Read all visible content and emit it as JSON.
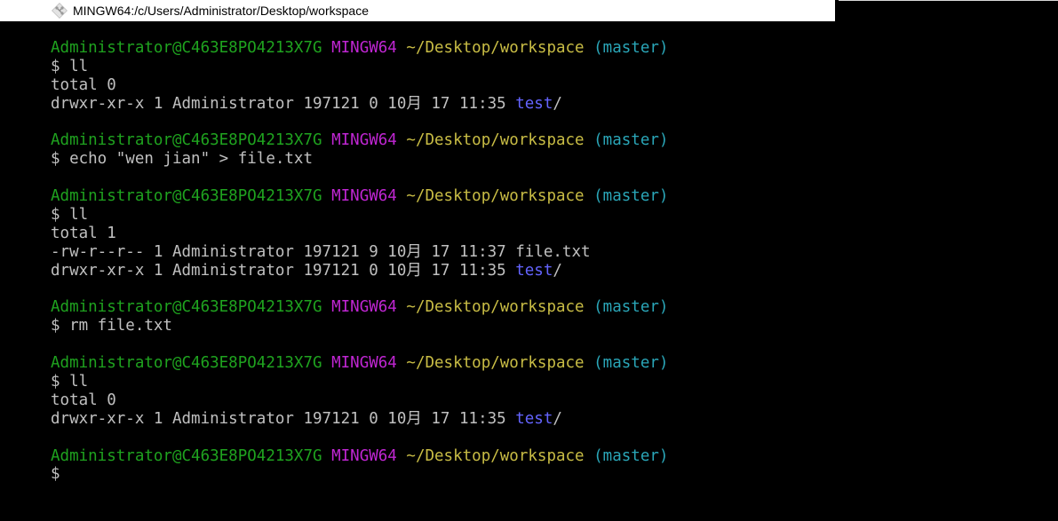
{
  "window": {
    "title": "MINGW64:/c/Users/Administrator/Desktop/workspace",
    "icon": "git-bash-icon"
  },
  "colors": {
    "background": "#000000",
    "default_text": "#c0c0c0",
    "user_host": "#1fa31f",
    "shell_name": "#c026d3",
    "path": "#c9bd45",
    "branch": "#2aa6b8",
    "directory": "#6464ff"
  },
  "terminal": {
    "lines": [
      {
        "type": "prompt",
        "segments": [
          {
            "text": "Administrator@C463E8PO4213X7G",
            "color": "user_host"
          },
          {
            "text": " "
          },
          {
            "text": "MINGW64",
            "color": "shell_name"
          },
          {
            "text": " "
          },
          {
            "text": "~/Desktop/workspace",
            "color": "path"
          },
          {
            "text": " "
          },
          {
            "text": "(master)",
            "color": "branch"
          }
        ]
      },
      {
        "type": "command",
        "segments": [
          {
            "text": "$ ll"
          }
        ]
      },
      {
        "type": "output",
        "segments": [
          {
            "text": "total 0"
          }
        ]
      },
      {
        "type": "output",
        "segments": [
          {
            "text": "drwxr-xr-x 1 Administrator 197121 0 10月 17 11:35 "
          },
          {
            "text": "test",
            "color": "directory"
          },
          {
            "text": "/"
          }
        ]
      },
      {
        "type": "blank",
        "segments": []
      },
      {
        "type": "prompt",
        "segments": [
          {
            "text": "Administrator@C463E8PO4213X7G",
            "color": "user_host"
          },
          {
            "text": " "
          },
          {
            "text": "MINGW64",
            "color": "shell_name"
          },
          {
            "text": " "
          },
          {
            "text": "~/Desktop/workspace",
            "color": "path"
          },
          {
            "text": " "
          },
          {
            "text": "(master)",
            "color": "branch"
          }
        ]
      },
      {
        "type": "command",
        "segments": [
          {
            "text": "$ echo \"wen jian\" > file.txt"
          }
        ]
      },
      {
        "type": "blank",
        "segments": []
      },
      {
        "type": "prompt",
        "segments": [
          {
            "text": "Administrator@C463E8PO4213X7G",
            "color": "user_host"
          },
          {
            "text": " "
          },
          {
            "text": "MINGW64",
            "color": "shell_name"
          },
          {
            "text": " "
          },
          {
            "text": "~/Desktop/workspace",
            "color": "path"
          },
          {
            "text": " "
          },
          {
            "text": "(master)",
            "color": "branch"
          }
        ]
      },
      {
        "type": "command",
        "segments": [
          {
            "text": "$ ll"
          }
        ]
      },
      {
        "type": "output",
        "segments": [
          {
            "text": "total 1"
          }
        ]
      },
      {
        "type": "output",
        "segments": [
          {
            "text": "-rw-r--r-- 1 Administrator 197121 9 10月 17 11:37 file.txt"
          }
        ]
      },
      {
        "type": "output",
        "segments": [
          {
            "text": "drwxr-xr-x 1 Administrator 197121 0 10月 17 11:35 "
          },
          {
            "text": "test",
            "color": "directory"
          },
          {
            "text": "/"
          }
        ]
      },
      {
        "type": "blank",
        "segments": []
      },
      {
        "type": "prompt",
        "segments": [
          {
            "text": "Administrator@C463E8PO4213X7G",
            "color": "user_host"
          },
          {
            "text": " "
          },
          {
            "text": "MINGW64",
            "color": "shell_name"
          },
          {
            "text": " "
          },
          {
            "text": "~/Desktop/workspace",
            "color": "path"
          },
          {
            "text": " "
          },
          {
            "text": "(master)",
            "color": "branch"
          }
        ]
      },
      {
        "type": "command",
        "segments": [
          {
            "text": "$ rm file.txt"
          }
        ]
      },
      {
        "type": "blank",
        "segments": []
      },
      {
        "type": "prompt",
        "segments": [
          {
            "text": "Administrator@C463E8PO4213X7G",
            "color": "user_host"
          },
          {
            "text": " "
          },
          {
            "text": "MINGW64",
            "color": "shell_name"
          },
          {
            "text": " "
          },
          {
            "text": "~/Desktop/workspace",
            "color": "path"
          },
          {
            "text": " "
          },
          {
            "text": "(master)",
            "color": "branch"
          }
        ]
      },
      {
        "type": "command",
        "segments": [
          {
            "text": "$ ll"
          }
        ]
      },
      {
        "type": "output",
        "segments": [
          {
            "text": "total 0"
          }
        ]
      },
      {
        "type": "output",
        "segments": [
          {
            "text": "drwxr-xr-x 1 Administrator 197121 0 10月 17 11:35 "
          },
          {
            "text": "test",
            "color": "directory"
          },
          {
            "text": "/"
          }
        ]
      },
      {
        "type": "blank",
        "segments": []
      },
      {
        "type": "prompt",
        "segments": [
          {
            "text": "Administrator@C463E8PO4213X7G",
            "color": "user_host"
          },
          {
            "text": " "
          },
          {
            "text": "MINGW64",
            "color": "shell_name"
          },
          {
            "text": " "
          },
          {
            "text": "~/Desktop/workspace",
            "color": "path"
          },
          {
            "text": " "
          },
          {
            "text": "(master)",
            "color": "branch"
          }
        ]
      },
      {
        "type": "command",
        "segments": [
          {
            "text": "$"
          }
        ]
      }
    ]
  }
}
